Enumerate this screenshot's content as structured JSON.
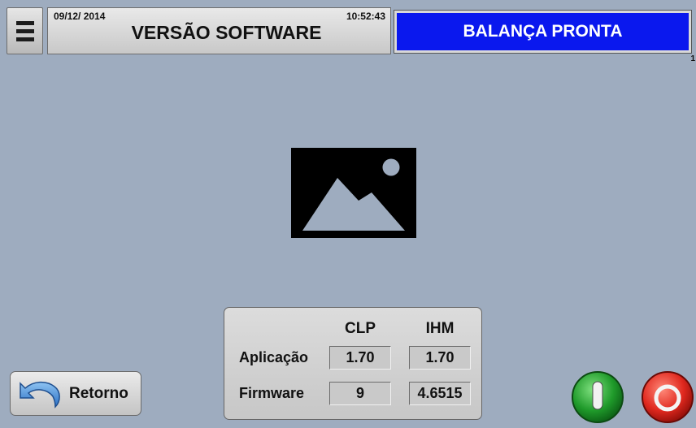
{
  "header": {
    "date": "09/12/ 2014",
    "time": "10:52:43",
    "title": "VERSÃO SOFTWARE"
  },
  "status": {
    "text": "BALANÇA PRONTA",
    "color": "#0a18ee"
  },
  "corner_number": "1",
  "versions": {
    "columns": [
      "CLP",
      "IHM"
    ],
    "rows": [
      {
        "label": "Aplicação",
        "clp": "1.70",
        "ihm": "1.70"
      },
      {
        "label": "Firmware",
        "clp": "9",
        "ihm": "4.6515"
      }
    ]
  },
  "buttons": {
    "back_label": "Retorno",
    "start_icon": "power-on-icon",
    "stop_icon": "power-off-icon"
  },
  "image_placeholder_icon": "image-placeholder-icon"
}
